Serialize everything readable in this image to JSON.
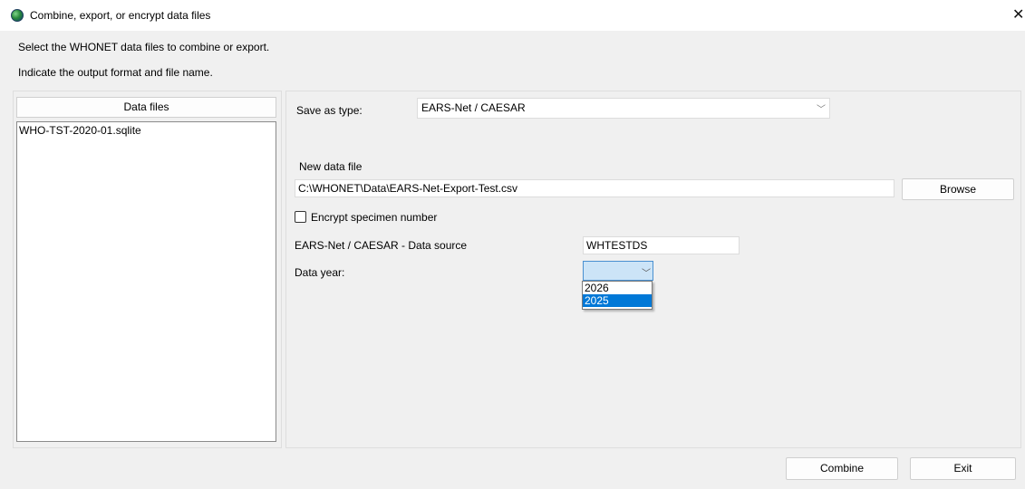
{
  "window": {
    "title": "Combine, export, or encrypt data files",
    "close_glyph": "✕"
  },
  "instructions": {
    "line1": "Select the WHONET data files to combine or export.",
    "line2": "Indicate the output format and file name."
  },
  "data_files": {
    "header": "Data files",
    "items": [
      "WHO-TST-2020-01.sqlite"
    ]
  },
  "form": {
    "save_as_type_label": "Save as type:",
    "save_as_type_value": "EARS-Net / CAESAR",
    "new_data_file_label": "New data file",
    "new_data_file_path": "C:\\WHONET\\Data\\EARS-Net-Export-Test.csv",
    "browse_label": "Browse",
    "encrypt_label": "Encrypt specimen number",
    "encrypt_checked": false,
    "data_source_label": "EARS-Net / CAESAR - Data source",
    "data_source_value": "WHTESTDS",
    "data_year_label": "Data year:",
    "data_year_value": "",
    "data_year_options": [
      "2026",
      "2025"
    ],
    "data_year_highlighted": "2025"
  },
  "footer": {
    "combine_label": "Combine",
    "exit_label": "Exit"
  },
  "colors": {
    "window_bg": "#f0f0f0",
    "selection_blue": "#0078d7",
    "focus_combo_bg": "#cce4f7"
  },
  "icons": {
    "app": "globe-icon",
    "dropdown": "chevron-down-icon",
    "close": "close-icon"
  }
}
